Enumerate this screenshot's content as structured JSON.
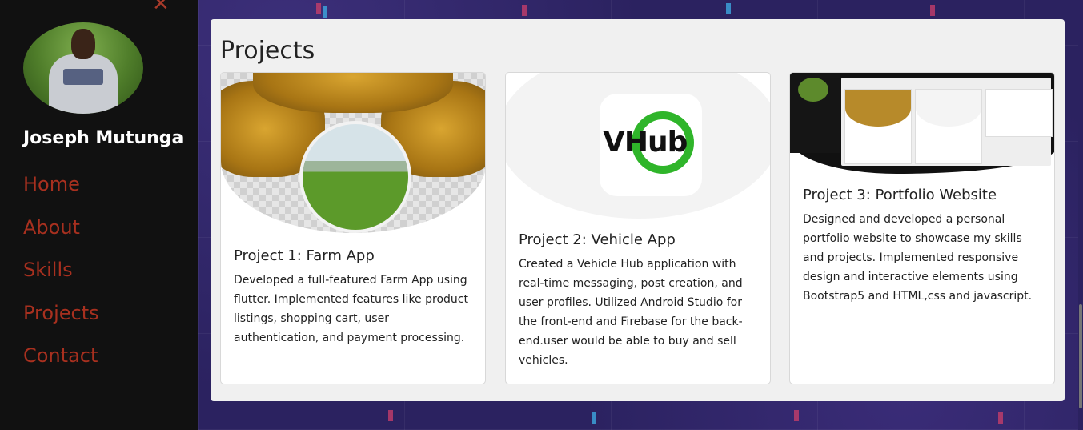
{
  "sidebar": {
    "user_name": "Joseph Mutunga",
    "nav": [
      "Home",
      "About",
      "Skills",
      "Projects",
      "Contact"
    ]
  },
  "projects": {
    "title": "Projects",
    "cards": [
      {
        "title": "Project 1: Farm App",
        "description": "Developed a full-featured Farm App using flutter. Implemented features like product listings, shopping cart, user authentication, and payment processing."
      },
      {
        "title": "Project 2: Vehicle App",
        "description": "Created a Vehicle Hub application with real-time messaging, post creation, and user profiles. Utilized Android Studio for the front-end and Firebase for the back-end.user would be able to buy and sell vehicles.",
        "logo_text": "VHub"
      },
      {
        "title": "Project 3: Portfolio Website",
        "description": "Designed and developed a personal portfolio website to showcase my skills and projects. Implemented responsive design and interactive elements using Bootstrap5 and HTML,css and javascript."
      }
    ]
  },
  "colors": {
    "sidebar_bg": "#111111",
    "nav_link": "#a8301f",
    "panel_bg": "#f0f0f0",
    "page_bg": "#2b2260"
  },
  "icons": {
    "close": "close-icon"
  }
}
